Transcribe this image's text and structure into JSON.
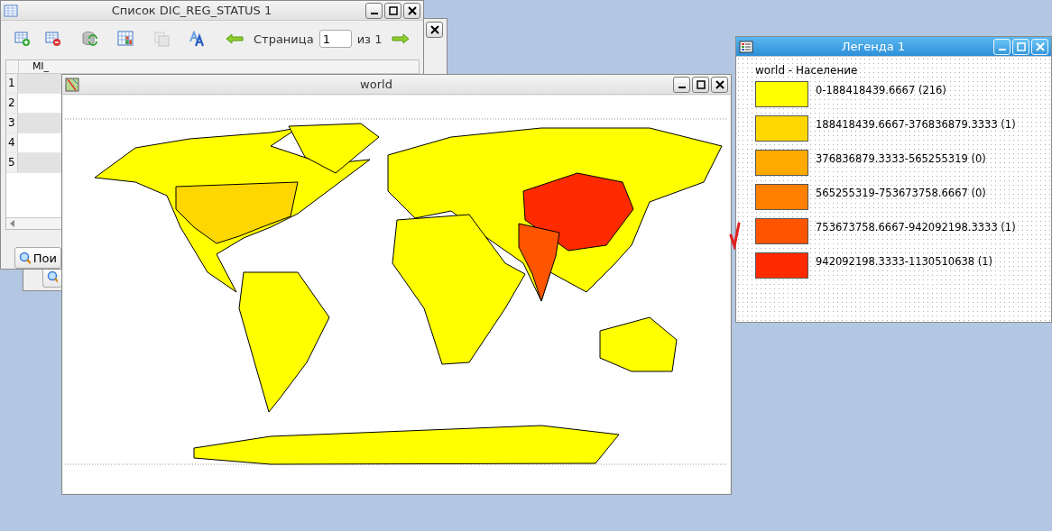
{
  "table_window": {
    "title": "Список DIC_REG_STATUS 1",
    "page_label": "Страница",
    "page_value": "1",
    "page_total": "из 1",
    "columns": [
      "MI_"
    ],
    "row_numbers": [
      "1",
      "2",
      "3",
      "4",
      "5"
    ],
    "search_button": "Пои"
  },
  "map_window": {
    "title": "world"
  },
  "legend_window": {
    "title": "Легенда  1",
    "heading": "world - Население",
    "items": [
      {
        "label": "0-188418439.6667 (216)",
        "color": "#ffff00"
      },
      {
        "label": "188418439.6667-376836879.3333 (1)",
        "color": "#ffd700"
      },
      {
        "label": "376836879.3333-565255319 (0)",
        "color": "#ffaa00"
      },
      {
        "label": "565255319-753673758.6667 (0)",
        "color": "#ff8000"
      },
      {
        "label": "753673758.6667-942092198.3333 (1)",
        "color": "#ff5500"
      },
      {
        "label": "942092198.3333-1130510638 (1)",
        "color": "#ff2a00"
      }
    ]
  }
}
